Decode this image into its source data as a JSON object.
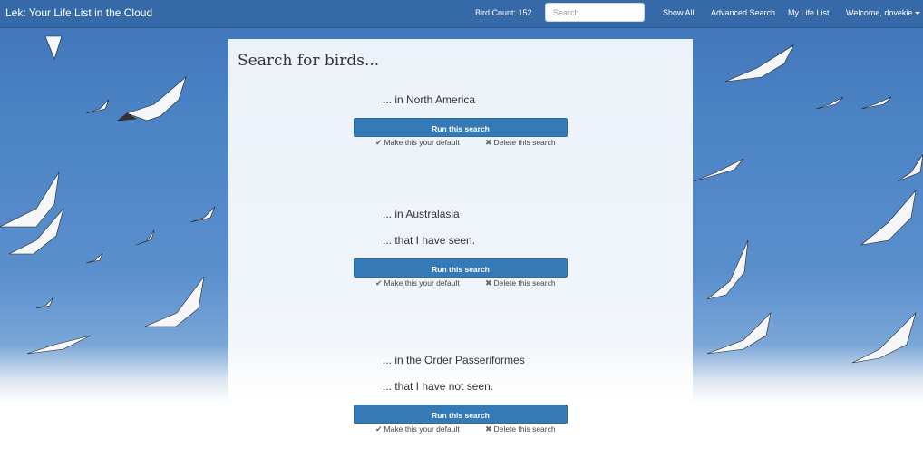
{
  "navbar": {
    "brand": "Lek: Your Life List in the Cloud",
    "bird_count": "Bird Count: 152",
    "search_placeholder": "Search",
    "links": {
      "show_all": "Show All",
      "advanced_search": "Advanced Search",
      "my_life_list": "My Life List",
      "welcome": "Welcome, dovekie"
    }
  },
  "main": {
    "title": "Search for birds...",
    "searches": [
      {
        "criteria": [
          "... in North America"
        ],
        "run_label": "Run this search",
        "default_label": "Make this your default",
        "delete_label": "Delete this search"
      },
      {
        "criteria": [
          "... in Australasia",
          "... that I have seen."
        ],
        "run_label": "Run this search",
        "default_label": "Make this your default",
        "delete_label": "Delete this search"
      },
      {
        "criteria": [
          "... in the Order Passeriformes",
          "... that I have not seen."
        ],
        "run_label": "Run this search",
        "default_label": "Make this your default",
        "delete_label": "Delete this search"
      }
    ]
  },
  "icons": {
    "check": "check-icon",
    "delete": "close-icon",
    "caret": "caret-down-icon"
  },
  "colors": {
    "navbar": "#3569a8",
    "button": "#337ab7",
    "sky": "#4a82c4"
  }
}
